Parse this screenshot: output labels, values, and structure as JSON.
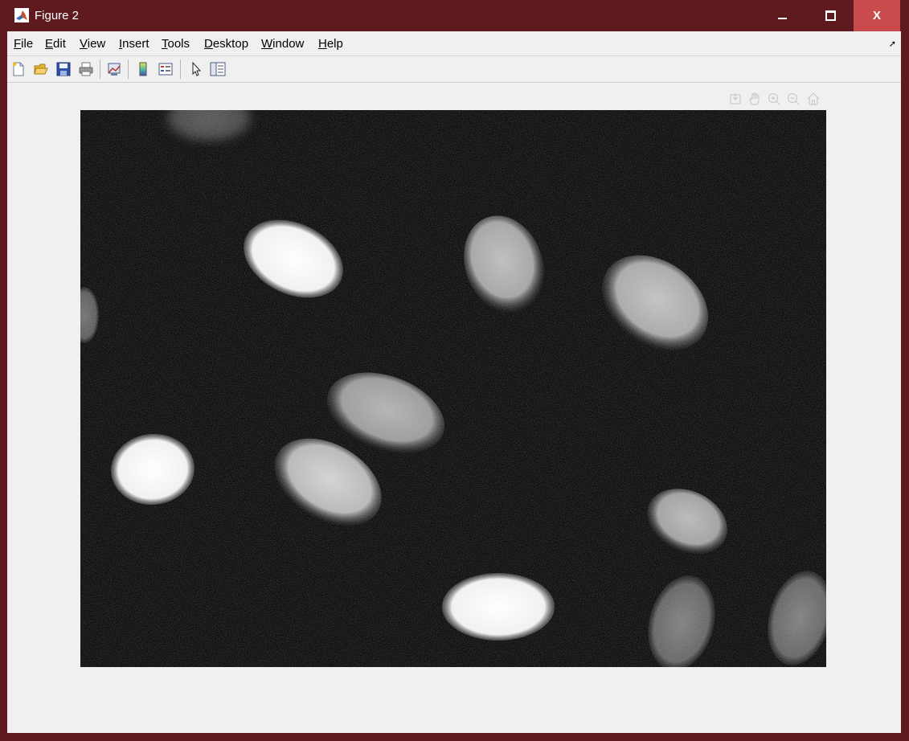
{
  "window": {
    "title": "Figure 2",
    "close_label": "X"
  },
  "menu": {
    "items": [
      {
        "key": "F",
        "rest": "ile"
      },
      {
        "key": "E",
        "rest": "dit"
      },
      {
        "key": "V",
        "rest": "iew"
      },
      {
        "key": "I",
        "rest": "nsert"
      },
      {
        "key": "T",
        "rest": "ools"
      },
      {
        "key": "D",
        "rest": "esktop"
      },
      {
        "key": "W",
        "rest": "indow"
      },
      {
        "key": "H",
        "rest": "elp"
      }
    ]
  },
  "toolbar": {
    "icons": [
      "new-figure-icon",
      "open-file-icon",
      "save-icon",
      "print-icon",
      "link-plot-icon",
      "colorbar-icon",
      "legend-icon",
      "edit-plot-arrow-icon",
      "property-inspector-icon"
    ]
  },
  "axes_toolbar": {
    "icons": [
      "export-icon",
      "pan-hand-icon",
      "zoom-in-icon",
      "zoom-out-icon",
      "home-icon"
    ]
  },
  "colors": {
    "window_frame": "#5e1a1f",
    "close_button": "#c94b4b",
    "client_bg": "#f0f0f0",
    "image_bg": "#090909"
  }
}
